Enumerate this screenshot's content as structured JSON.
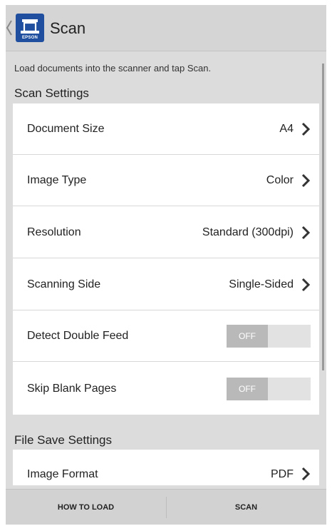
{
  "header": {
    "title": "Scan",
    "logo_text": "EPSON",
    "back_icon": "chevron-left-icon",
    "logo_icon": "scanner-app-icon"
  },
  "instruction": "Load documents into the scanner and tap Scan.",
  "scan_settings": {
    "title": "Scan Settings",
    "rows": [
      {
        "label": "Document Size",
        "value": "A4"
      },
      {
        "label": "Image Type",
        "value": "Color"
      },
      {
        "label": "Resolution",
        "value": "Standard (300dpi)"
      },
      {
        "label": "Scanning Side",
        "value": "Single-Sided"
      }
    ],
    "toggles": [
      {
        "label": "Detect Double Feed",
        "state": "OFF"
      },
      {
        "label": "Skip Blank Pages",
        "state": "OFF"
      }
    ]
  },
  "file_save_settings": {
    "title": "File Save Settings",
    "rows": [
      {
        "label": "Image Format",
        "value": "PDF"
      }
    ]
  },
  "bottom_bar": {
    "how_to_load": "HOW TO LOAD",
    "scan": "SCAN"
  },
  "colors": {
    "accent": "#1f4f9e",
    "background": "#dcdcdc",
    "toggle_off": "#b9b9b9"
  }
}
